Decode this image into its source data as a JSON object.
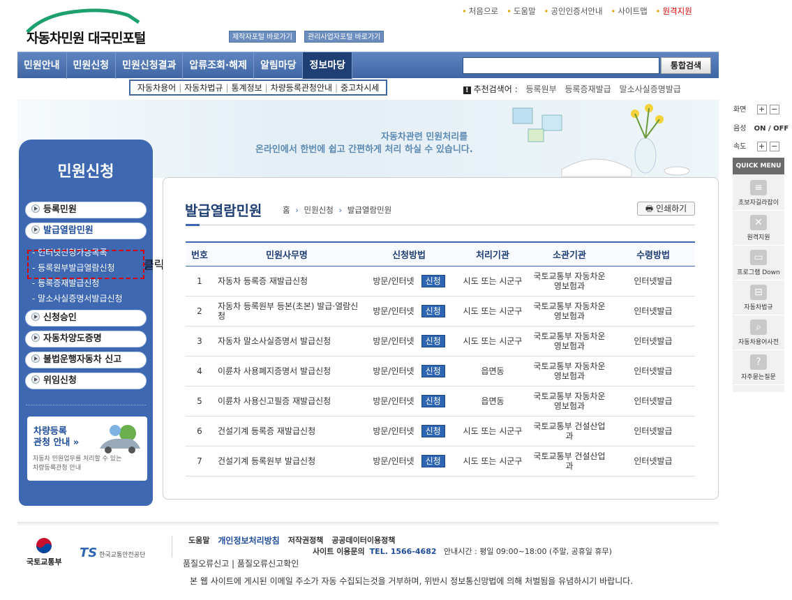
{
  "util_links": [
    "처음으로",
    "도움말",
    "공인인증서안내",
    "사이트맵"
  ],
  "util_remote": "원격지원",
  "logo_text": "자동차민원 대국민포털",
  "portal_buttons": [
    "제작자포털 바로가기",
    "관리사업자포털 바로가기"
  ],
  "gnb": [
    "민원안내",
    "민원신청",
    "민원신청결과",
    "압류조회·해제",
    "알림마당",
    "정보마당"
  ],
  "search": {
    "placeholder": "",
    "button": "통합검색"
  },
  "submenu": [
    "자동차용어",
    "자동차법규",
    "통계정보",
    "차량등록관청안내",
    "중고차시세"
  ],
  "recommend": {
    "label": "추천검색어 :",
    "keywords": [
      "등록원부",
      "등록증재발급",
      "말소사실증명발급"
    ]
  },
  "banner": {
    "line1": "자동차관련 민원처리를",
    "line2": "온라인에서 한번에 쉽고 간편하게 처리 하실 수 있습니다."
  },
  "sidebar": {
    "title": "민원신청",
    "items": [
      "등록민원",
      "발급열람민원",
      "신청승인",
      "자동차양도증명",
      "불법운행자동차 신고",
      "위임신청"
    ],
    "subitems": [
      "인터넷신청가능목록",
      "등록원부발급열람신청",
      "등록증재발급신청",
      "말소사실증명서발급신청"
    ],
    "box_title1": "차량등록",
    "box_title2": "관청 안내 »",
    "box_desc1": "자동차 민원업무를 처리할 수 있는",
    "box_desc2": "차량등록관청 안내"
  },
  "annotation": "클릭합니다.",
  "content": {
    "title": "발급열람민원",
    "breadcrumb": [
      "홈",
      "민원신청",
      "발급열람민원"
    ],
    "print": "인쇄하기",
    "columns": [
      "번호",
      "민원사무명",
      "신청방법",
      "처리기관",
      "소관기관",
      "수령방법"
    ],
    "rows": [
      {
        "no": "1",
        "name": "자동차 등록증 재발급신청",
        "method": "방문/인터넷",
        "btn": "신청",
        "proc": "시도 또는 시군구",
        "org": "국토교통부 자동차운영보험과",
        "recv": "인터넷발급"
      },
      {
        "no": "2",
        "name": "자동차 등록원부 등본(초본) 발급·열람신청",
        "method": "방문/인터넷",
        "btn": "신청",
        "proc": "시도 또는 시군구",
        "org": "국토교통부 자동차운영보험과",
        "recv": "인터넷발급"
      },
      {
        "no": "3",
        "name": "자동차 말소사실증명서 발급신청",
        "method": "방문/인터넷",
        "btn": "신청",
        "proc": "시도 또는 시군구",
        "org": "국토교통부 자동차운영보험과",
        "recv": "인터넷발급"
      },
      {
        "no": "4",
        "name": "이륜차 사용폐지증명서 발급신청",
        "method": "방문/인터넷",
        "btn": "신청",
        "proc": "읍면동",
        "org": "국토교통부 자동차운영보험과",
        "recv": "인터넷발급"
      },
      {
        "no": "5",
        "name": "이륜차 사용신고필증 재발급신청",
        "method": "방문/인터넷",
        "btn": "신청",
        "proc": "읍면동",
        "org": "국토교통부 자동차운영보험과",
        "recv": "인터넷발급"
      },
      {
        "no": "6",
        "name": "건설기계 등록증 재발급신청",
        "method": "방문/인터넷",
        "btn": "신청",
        "proc": "시도 또는 시군구",
        "org": "국토교통부 건설산업과",
        "recv": "인터넷발급"
      },
      {
        "no": "7",
        "name": "건설기계 등록원부 발급신청",
        "method": "방문/인터넷",
        "btn": "신청",
        "proc": "시도 또는 시군구",
        "org": "국토교통부 건설산업과",
        "recv": "인터넷발급"
      }
    ]
  },
  "quick": {
    "screen": "화면",
    "voice": "음성",
    "voice_state": "ON / OFF",
    "speed": "속도",
    "head": "QUICK MENU",
    "items": [
      "초보자길라잡이",
      "원격지원",
      "프로그램 Down",
      "자동차법규",
      "자동차용어사전",
      "자주묻는질문"
    ]
  },
  "footer": {
    "logo1": "국토교통부",
    "logo2": "한국교통안전공단",
    "links": [
      "도움말",
      "개인정보처리방침",
      "저작권정책",
      "공공데이터이용정책"
    ],
    "tel_label": "사이트 이용문의",
    "tel": "TEL. 1566-4682",
    "hours": "안내시간 : 평일 09:00~18:00 (주말, 공휴일 휴무)",
    "error_links": "품질오류신고 | 품질오류신고확인",
    "notice": "본 웹 사이트에 게시된 이메일 주소가 자동 수집되는것을 거부하며, 위반시 정보통신망법에 의해 처벌됨을 유념하시기 바랍니다."
  }
}
